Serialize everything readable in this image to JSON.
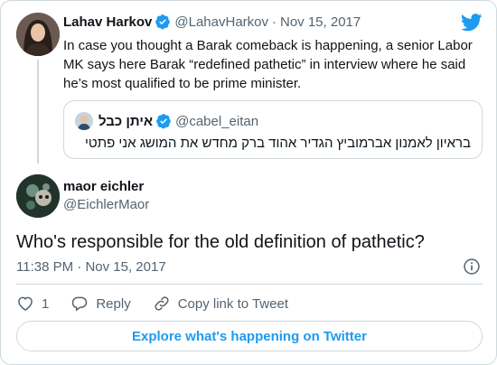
{
  "parent_tweet": {
    "author_name": "Lahav Harkov",
    "handle": "@LahavHarkov",
    "separator": "·",
    "date": "Nov 15, 2017",
    "text": "In case you thought a Barak comeback is happening, a senior Labor MK says here Barak “redefined pathetic” in interview where he said he’s most qualified to be prime minister."
  },
  "quoted_tweet": {
    "author_name": "איתן כבל",
    "handle": "@cabel_eitan",
    "text": "בראיון לאמנון אברמוביץ הגדיר אהוד ברק מחדש את המושג אני פתטי"
  },
  "main_tweet": {
    "author_name": "maor eichler",
    "handle": "@EichlerMaor",
    "text": "Who's responsible for the old definition of pathetic?",
    "time": "11:38 PM",
    "separator": "·",
    "date": "Nov 15, 2017"
  },
  "actions": {
    "like_count": "1",
    "reply_label": "Reply",
    "copy_link_label": "Copy link to Tweet"
  },
  "explore_label": "Explore what's happening on Twitter",
  "colors": {
    "accent": "#1d9bf0",
    "verified": "#1d9bf0",
    "secondary_text": "#536471",
    "border": "#cfd9de"
  },
  "icons": [
    "verified-badge-icon",
    "twitter-bird-icon",
    "info-icon",
    "heart-icon",
    "reply-icon",
    "link-icon"
  ]
}
